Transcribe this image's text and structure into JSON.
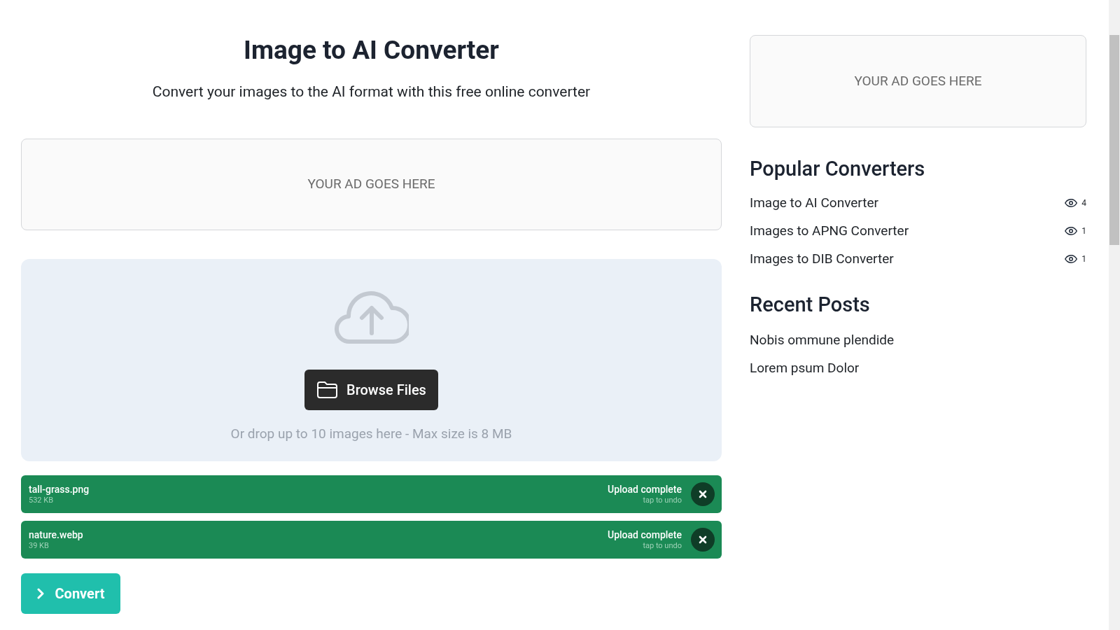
{
  "header": {
    "title": "Image to AI Converter",
    "subtitle": "Convert your images to the AI format with this free online converter"
  },
  "main_ad": {
    "label": "YOUR AD GOES HERE"
  },
  "dropzone": {
    "button": "Browse Files",
    "hint": "Or drop up to 10 images here - Max size is 8 MB"
  },
  "files": [
    {
      "name": "tall-grass.png",
      "size": "532 KB",
      "status": "Upload complete",
      "action_hint": "tap to undo"
    },
    {
      "name": "nature.webp",
      "size": "39 KB",
      "status": "Upload complete",
      "action_hint": "tap to undo"
    }
  ],
  "convert_button": {
    "label": "Convert"
  },
  "sidebar": {
    "ad": {
      "label": "YOUR AD GOES HERE"
    },
    "popular": {
      "title": "Popular Converters",
      "items": [
        {
          "label": "Image to AI Converter",
          "views": "4"
        },
        {
          "label": "Images to APNG Converter",
          "views": "1"
        },
        {
          "label": "Images to DIB Converter",
          "views": "1"
        }
      ]
    },
    "recent": {
      "title": "Recent Posts",
      "items": [
        "Nobis ommune plendide",
        "Lorem psum Dolor"
      ]
    }
  }
}
